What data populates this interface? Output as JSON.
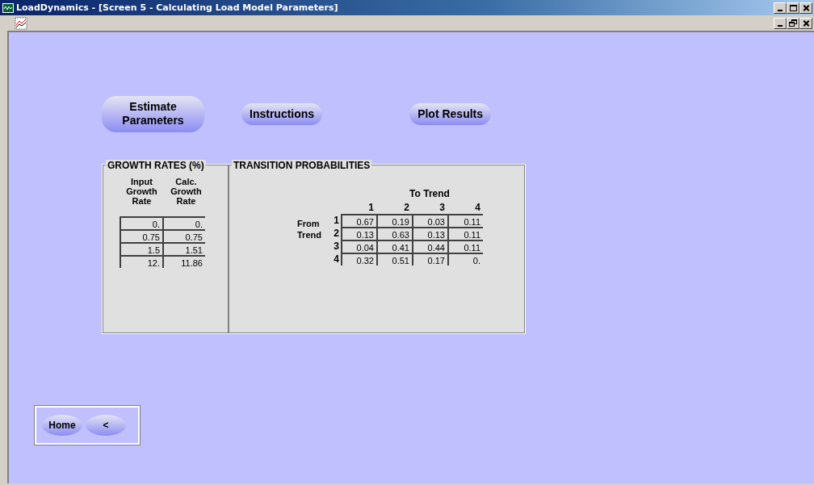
{
  "window": {
    "title": "LoadDynamics - [Screen 5 - Calculating Load Model Parameters]"
  },
  "actions": [
    {
      "label": "Estimate Parameters",
      "kind": "large"
    },
    {
      "label": "Instructions",
      "kind": "small"
    },
    {
      "label": "Plot Results",
      "kind": "small"
    }
  ],
  "growth_rates": {
    "title": "GROWTH RATES (%)",
    "columns": [
      "Input Growth Rate",
      "Calc. Growth Rate"
    ],
    "rows": [
      [
        "0.",
        "0."
      ],
      [
        "0.75",
        "0.75"
      ],
      [
        "1.5",
        "1.51"
      ],
      [
        "12.",
        "11.86"
      ]
    ]
  },
  "transition_probabilities": {
    "title": "TRANSITION PROBABILITIES",
    "to_label": "To Trend",
    "from_label": "From Trend",
    "columns": [
      "1",
      "2",
      "3",
      "4"
    ],
    "rows": [
      {
        "label": "1",
        "values": [
          "0.67",
          "0.19",
          "0.03",
          "0.11"
        ]
      },
      {
        "label": "2",
        "values": [
          "0.13",
          "0.63",
          "0.13",
          "0.11"
        ]
      },
      {
        "label": "3",
        "values": [
          "0.04",
          "0.41",
          "0.44",
          "0.11"
        ]
      },
      {
        "label": "4",
        "values": [
          "0.32",
          "0.51",
          "0.17",
          "0."
        ]
      }
    ]
  },
  "navigation": [
    {
      "label": "Home"
    },
    {
      "label": "<"
    }
  ]
}
